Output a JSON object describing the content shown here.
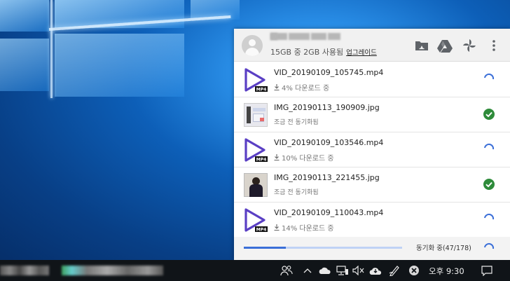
{
  "panel": {
    "account_name": "█████████████",
    "storage_text": "15GB 중 2GB 사용됨",
    "upgrade_label": "업그레이드",
    "header_icons": [
      "drive-folder-icon",
      "google-drive-icon",
      "google-photos-icon",
      "more-vert-icon"
    ]
  },
  "files": [
    {
      "name": "VID_20190109_105745.mp4",
      "status": "4% 다운로드 중",
      "kind": "video",
      "state": "syncing",
      "progress": 0.04
    },
    {
      "name": "IMG_20190113_190909.jpg",
      "status": "조금 전 동기화됨",
      "kind": "image",
      "state": "done"
    },
    {
      "name": "VID_20190109_103546.mp4",
      "status": "10% 다운로드 중",
      "kind": "video",
      "state": "syncing",
      "progress": 0.1
    },
    {
      "name": "IMG_20190113_221455.jpg",
      "status": "조금 전 동기화됨",
      "kind": "image",
      "state": "done"
    },
    {
      "name": "VID_20190109_110043.mp4",
      "status": "14% 다운로드 중",
      "kind": "video",
      "state": "syncing",
      "progress": 0.14
    }
  ],
  "footer": {
    "sync_text": "동기화 중(47/178)",
    "synced": 47,
    "total": 178
  },
  "taskbar": {
    "time": "오후 9:30",
    "tray_icons": [
      "people-icon",
      "chevron-up-icon",
      "onedrive-icon",
      "network-icon",
      "volume-muted-icon",
      "backup-sync-icon",
      "pen-icon",
      "close-circle-icon",
      "action-center-icon"
    ]
  },
  "colors": {
    "accent": "#3b6fd8",
    "video_purple": "#5a3fc4",
    "success_green": "#2e8b3a",
    "taskbar": "#101418"
  }
}
